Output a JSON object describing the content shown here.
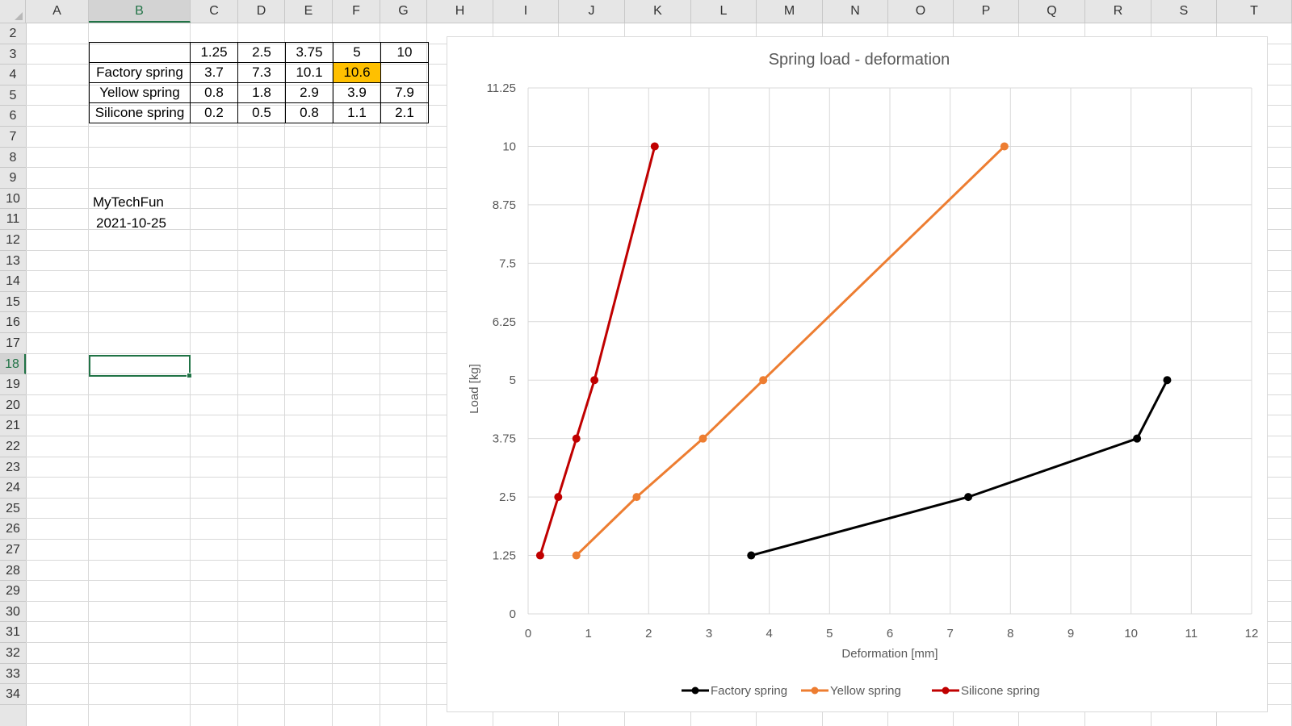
{
  "columns": [
    "A",
    "B",
    "C",
    "D",
    "E",
    "F",
    "G",
    "H",
    "I",
    "J",
    "K",
    "L",
    "M",
    "N",
    "O",
    "P",
    "Q",
    "R",
    "S",
    "T"
  ],
  "rows": [
    "2",
    "3",
    "4",
    "5",
    "6",
    "7",
    "8",
    "9",
    "10",
    "11",
    "12",
    "13",
    "14",
    "15",
    "16",
    "17",
    "18",
    "19",
    "20",
    "21",
    "22",
    "23",
    "24",
    "25",
    "26",
    "27",
    "28",
    "29",
    "30",
    "31",
    "32",
    "33",
    "34"
  ],
  "active_column": "B",
  "active_row": "18",
  "table": {
    "header": [
      "",
      "1.25",
      "2.5",
      "3.75",
      "5",
      "10"
    ],
    "rows": [
      {
        "label": "Factory spring",
        "values": [
          "3.7",
          "7.3",
          "10.1",
          "10.6",
          ""
        ]
      },
      {
        "label": "Yellow spring",
        "values": [
          "0.8",
          "1.8",
          "2.9",
          "3.9",
          "7.9"
        ]
      },
      {
        "label": "Silicone spring",
        "values": [
          "0.2",
          "0.5",
          "0.8",
          "1.1",
          "2.1"
        ]
      }
    ],
    "highlight_color": "#ffc000"
  },
  "notes": {
    "author": "MyTechFun",
    "date": "2021-10-25"
  },
  "chart_data": {
    "type": "line",
    "title": "Spring load - deformation",
    "xlabel": "Deformation [mm]",
    "ylabel": "Load [kg]",
    "xlim": [
      0,
      12
    ],
    "ylim": [
      0,
      11.25
    ],
    "x_ticks": [
      "0",
      "1",
      "2",
      "3",
      "4",
      "5",
      "6",
      "7",
      "8",
      "9",
      "10",
      "11",
      "12"
    ],
    "y_ticks": [
      "0",
      "1.25",
      "2.5",
      "3.75",
      "5",
      "6.25",
      "7.5",
      "8.75",
      "10",
      "11.25"
    ],
    "grid": true,
    "legend_position": "bottom",
    "series": [
      {
        "name": "Factory spring",
        "color": "#000000",
        "x": [
          3.7,
          7.3,
          10.1,
          10.6
        ],
        "y": [
          1.25,
          2.5,
          3.75,
          5
        ]
      },
      {
        "name": "Yellow spring",
        "color": "#ed7d31",
        "x": [
          0.8,
          1.8,
          2.9,
          3.9,
          7.9
        ],
        "y": [
          1.25,
          2.5,
          3.75,
          5,
          10
        ]
      },
      {
        "name": "Silicone spring",
        "color": "#c00000",
        "x": [
          0.2,
          0.5,
          0.8,
          1.1,
          2.1
        ],
        "y": [
          1.25,
          2.5,
          3.75,
          5,
          10
        ]
      }
    ]
  }
}
